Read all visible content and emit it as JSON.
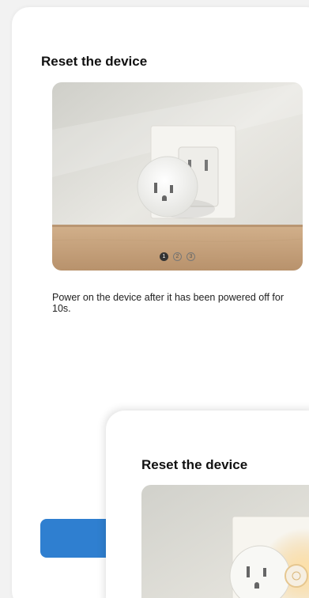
{
  "reset_screen": {
    "title": "Reset the device",
    "steps": [
      "1",
      "2",
      "3"
    ],
    "active_step": 1,
    "description": "Power on the device after it has been powered off for 10s."
  },
  "overlay_screen": {
    "title": "Reset the device"
  },
  "colors": {
    "primary_button": "#2f7fd0",
    "card_background": "#ffffff",
    "page_background": "#f2f2f2"
  }
}
